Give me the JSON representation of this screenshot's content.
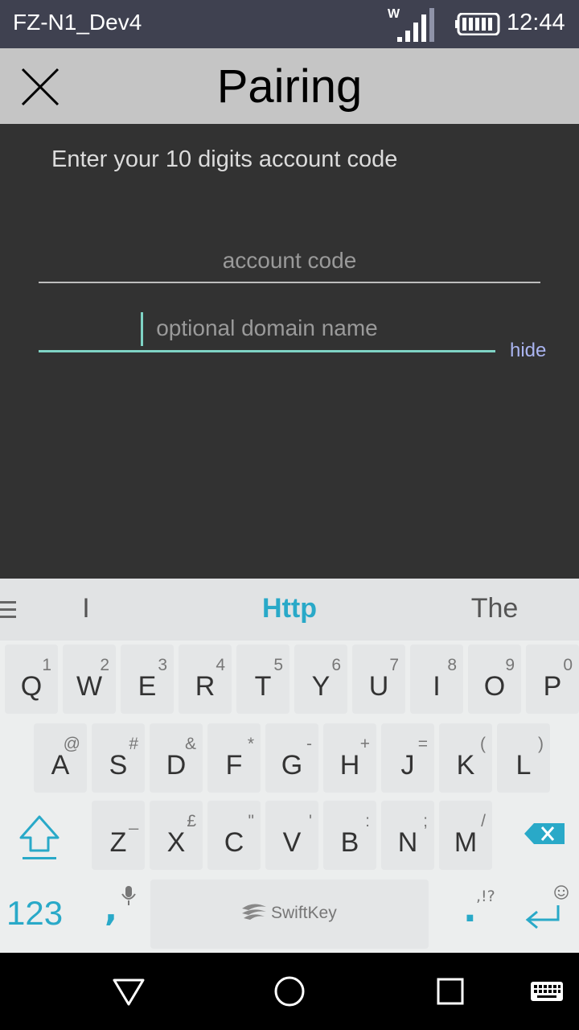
{
  "status_bar": {
    "carrier": "FZ-N1_Dev4",
    "network_badge": "W",
    "time": "12:44",
    "signal_icon": "signal-icon",
    "battery_icon": "battery-icon"
  },
  "header": {
    "title": "Pairing",
    "close_icon": "close-icon"
  },
  "form": {
    "instruction": "Enter your 10 digits account code",
    "account_code_placeholder": "account code",
    "domain_placeholder": "optional domain name",
    "hide_label": "hide"
  },
  "keyboard": {
    "suggestions": [
      "I",
      "Http",
      "The"
    ],
    "row1": [
      {
        "key": "Q",
        "sub": "1"
      },
      {
        "key": "W",
        "sub": "2"
      },
      {
        "key": "E",
        "sub": "3"
      },
      {
        "key": "R",
        "sub": "4"
      },
      {
        "key": "T",
        "sub": "5"
      },
      {
        "key": "Y",
        "sub": "6"
      },
      {
        "key": "U",
        "sub": "7"
      },
      {
        "key": "I",
        "sub": "8"
      },
      {
        "key": "O",
        "sub": "9"
      },
      {
        "key": "P",
        "sub": "0"
      }
    ],
    "row2": [
      {
        "key": "A",
        "sub": "@"
      },
      {
        "key": "S",
        "sub": "#"
      },
      {
        "key": "D",
        "sub": "&"
      },
      {
        "key": "F",
        "sub": "*"
      },
      {
        "key": "G",
        "sub": "-"
      },
      {
        "key": "H",
        "sub": "+"
      },
      {
        "key": "J",
        "sub": "="
      },
      {
        "key": "K",
        "sub": "("
      },
      {
        "key": "L",
        "sub": ")"
      }
    ],
    "row3": [
      {
        "key": "Z",
        "sub": "_"
      },
      {
        "key": "X",
        "sub": "£"
      },
      {
        "key": "C",
        "sub": "\""
      },
      {
        "key": "V",
        "sub": "'"
      },
      {
        "key": "B",
        "sub": ":"
      },
      {
        "key": "N",
        "sub": ";"
      },
      {
        "key": "M",
        "sub": "/"
      }
    ],
    "num_label": "123",
    "comma_label": ",",
    "space_label": "SwiftKey",
    "period_label": ".",
    "period_sub": ",!?",
    "accent_color": "#29a9c8"
  }
}
